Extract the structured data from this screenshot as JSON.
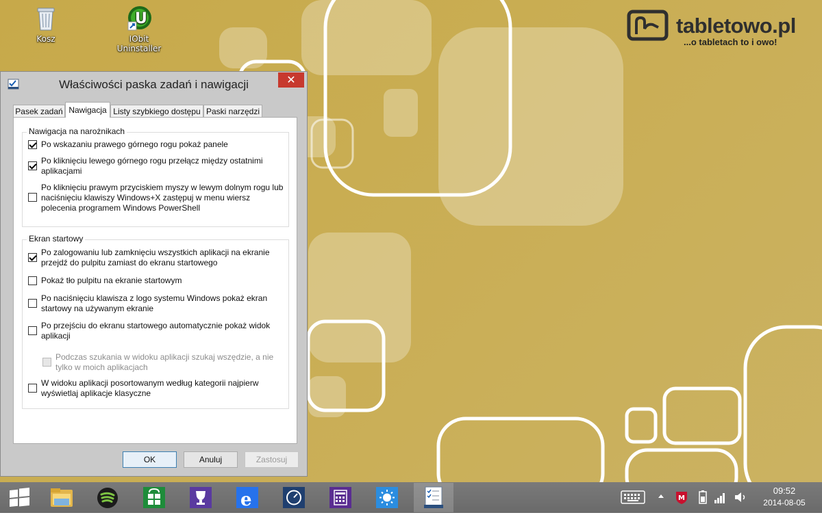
{
  "desktop": {
    "icons": [
      {
        "label": "Kosz"
      },
      {
        "label": "IObit Uninstaller"
      }
    ],
    "brand": {
      "name": "tabletowo.pl",
      "tagline": "...o tabletach to i owo!"
    }
  },
  "dialog": {
    "title": "Właściwości paska zadań i nawigacji",
    "close_label": "✕",
    "tabs": [
      {
        "label": "Pasek zadań",
        "active": false
      },
      {
        "label": "Nawigacja",
        "active": true
      },
      {
        "label": "Listy szybkiego dostępu",
        "active": false
      },
      {
        "label": "Paski narzędzi",
        "active": false
      }
    ],
    "groups": [
      {
        "label": "Nawigacja na narożnikach",
        "options": [
          {
            "line1": "Po wskazaniu prawego górnego rogu pokaż panele",
            "line2": "",
            "line3": "",
            "checked": true,
            "enabled": true
          },
          {
            "line1": "Po kliknięciu lewego górnego rogu przełącz między ostatnimi",
            "line2": "aplikacjami",
            "line3": "",
            "checked": true,
            "enabled": true
          },
          {
            "line1": "Po kliknięciu prawym przyciskiem myszy w lewym dolnym rogu lub",
            "line2": "naciśnięciu klawiszy Windows+X zastępuj w menu wiersz",
            "line3": "polecenia programem Windows PowerShell",
            "checked": false,
            "enabled": true
          }
        ]
      },
      {
        "label": "Ekran startowy",
        "options": [
          {
            "line1": "Po zalogowaniu lub zamknięciu wszystkich aplikacji na ekranie",
            "line2": "przejdź do pulpitu zamiast do ekranu startowego",
            "line3": "",
            "checked": true,
            "enabled": true
          },
          {
            "line1": "Pokaż tło pulpitu na ekranie startowym",
            "line2": "",
            "line3": "",
            "checked": false,
            "enabled": true
          },
          {
            "line1": "Po naciśnięciu klawisza z logo systemu Windows pokaż ekran",
            "line2": "startowy na używanym ekranie",
            "line3": "",
            "checked": false,
            "enabled": true
          },
          {
            "line1": "Po przejściu do ekranu startowego automatycznie pokaż widok",
            "line2": "aplikacji",
            "line3": "",
            "checked": false,
            "enabled": true
          },
          {
            "line1": "Podczas szukania w widoku aplikacji szukaj wszędzie, a nie",
            "line2": "tylko w moich aplikacjach",
            "line3": "",
            "checked": false,
            "enabled": false
          },
          {
            "line1": "W widoku aplikacji posortowanym według kategorii najpierw",
            "line2": "wyświetlaj aplikacje klasyczne",
            "line3": "",
            "checked": false,
            "enabled": true
          }
        ]
      }
    ],
    "buttons": {
      "ok": "OK",
      "cancel": "Anuluj",
      "apply": "Zastosuj"
    }
  },
  "taskbar": {
    "apps": [
      "start-icon",
      "file-explorer-icon",
      "spotify-icon",
      "store-icon",
      "trophy-icon",
      "internet-explorer-icon",
      "clock-app-icon",
      "calculator-icon",
      "weather-icon",
      "taskbar-properties-icon"
    ],
    "clock": {
      "time": "09:52",
      "date": "2014-08-05"
    },
    "colors": {
      "taskbar": "#6e6e6e",
      "accent": "#c7392e",
      "store_green": "#1e8c3a"
    }
  }
}
